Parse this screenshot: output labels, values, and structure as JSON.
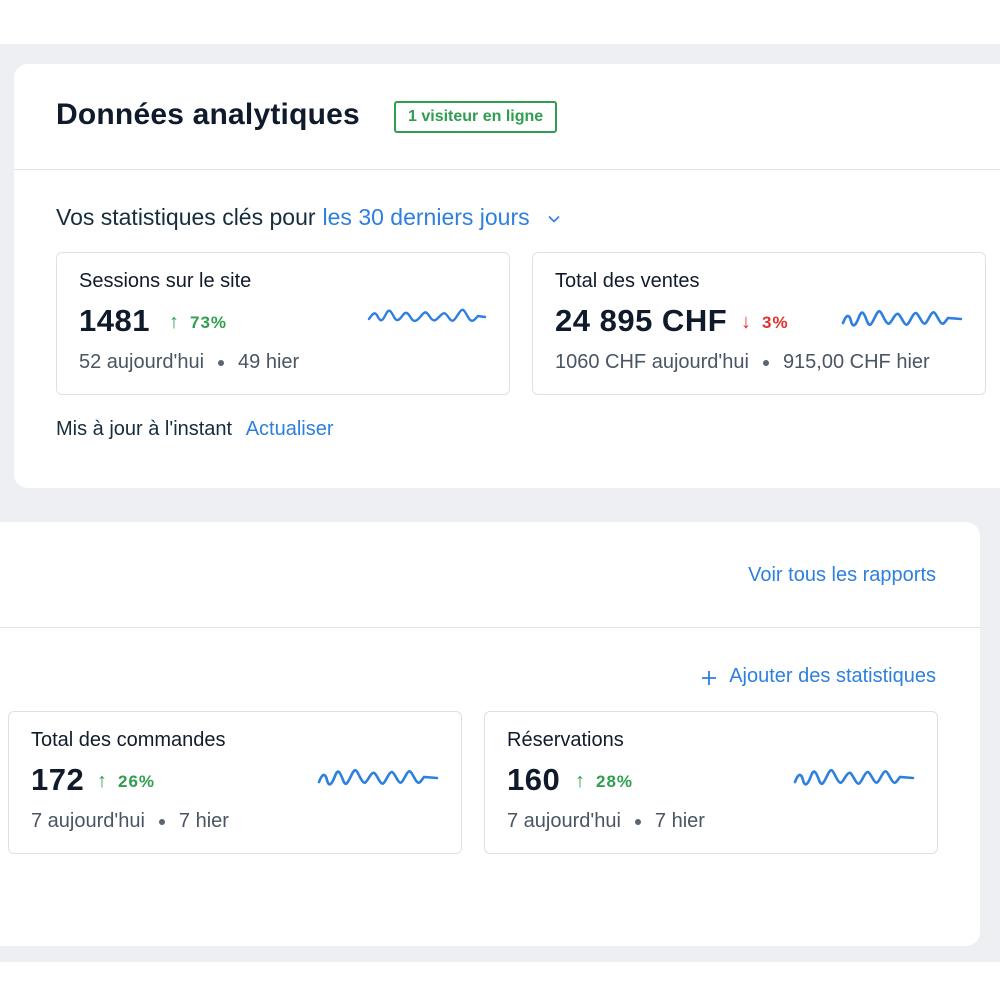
{
  "header": {
    "title": "Données analytiques",
    "online_badge": "1 visiteur en ligne"
  },
  "key_stats": {
    "prefix": "Vos statistiques clés pour",
    "period": "les 30 derniers jours",
    "chevron_icon": "chevron-down-icon"
  },
  "cards_top": [
    {
      "title": "Sessions sur le site",
      "value": "1481",
      "change": "73%",
      "trend": "up",
      "today": "52 aujourd'hui",
      "yesterday": "49 hier"
    },
    {
      "title": "Total des ventes",
      "value": "24 895 CHF",
      "change": "3%",
      "trend": "down",
      "today": "1060 CHF aujourd'hui",
      "yesterday": "915,00 CHF hier"
    }
  ],
  "updated": {
    "text": "Mis à jour à l'instant",
    "refresh_label": "Actualiser"
  },
  "reports": {
    "link_label": "Voir tous les rapports",
    "add_label": "Ajouter des statistiques",
    "add_icon": "plus-icon"
  },
  "cards_bottom": [
    {
      "title": "Total des commandes",
      "value": "172",
      "change": "26%",
      "trend": "up",
      "today": "7 aujourd'hui",
      "yesterday": "7 hier"
    },
    {
      "title": "Réservations",
      "value": "160",
      "change": "28%",
      "trend": "up",
      "today": "7 aujourd'hui",
      "yesterday": "7 hier"
    }
  ],
  "colors": {
    "accent": "#2d7fe0",
    "positive": "#2f9e4f",
    "negative": "#e0312c",
    "sparkline": "#2d7fe0",
    "background": "#edeff2"
  }
}
